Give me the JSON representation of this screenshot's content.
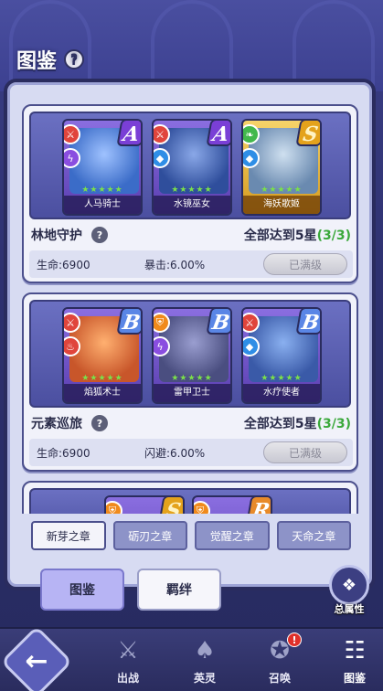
{
  "header": {
    "title": "图鉴",
    "help_icon": "?"
  },
  "sets": [
    {
      "name": "林地守护",
      "requirement": "全部达到5星",
      "progress": "(3/3)",
      "stat1": "生命:6900",
      "stat2": "暴击:6.00%",
      "button": "已满级",
      "heroes": [
        {
          "name": "人马骑士",
          "grade": "A",
          "frame": "purple",
          "stars": "★★★★★",
          "badges": [
            "red",
            "purple"
          ],
          "portrait": "#3b6cc8"
        },
        {
          "name": "水镜巫女",
          "grade": "A",
          "frame": "purple",
          "stars": "★★★★★",
          "badges": [
            "red",
            "blue"
          ],
          "portrait": "#2f4e9c"
        },
        {
          "name": "海妖歌姬",
          "grade": "S",
          "frame": "gold",
          "stars": "★★★★★",
          "badges": [
            "green",
            "blue"
          ],
          "portrait": "#6a8ab0"
        }
      ]
    },
    {
      "name": "元素巡旅",
      "requirement": "全部达到5星",
      "progress": "(3/3)",
      "stat1": "生命:6900",
      "stat2": "闪避:6.00%",
      "button": "已满级",
      "heroes": [
        {
          "name": "焰狐术士",
          "grade": "B",
          "frame": "purple",
          "stars": "★★★★★",
          "badges": [
            "red",
            "red"
          ],
          "portrait": "#c8562a"
        },
        {
          "name": "雷甲卫士",
          "grade": "B",
          "frame": "purple",
          "stars": "★★★★★",
          "badges": [
            "orange",
            "purple"
          ],
          "portrait": "#4a4e80"
        },
        {
          "name": "水疗使者",
          "grade": "B",
          "frame": "purple",
          "stars": "★★★★★",
          "badges": [
            "red",
            "blue"
          ],
          "portrait": "#3a5aa8"
        }
      ]
    },
    {
      "heroes": [
        {
          "grade": "S",
          "badge": "orange"
        },
        {
          "grade": "R",
          "badge": "orange"
        }
      ]
    }
  ],
  "chapters": [
    "新芽之章",
    "砺刃之章",
    "觉醒之章",
    "天命之章"
  ],
  "tabs": {
    "catalog": "图鉴",
    "bond": "羁绊"
  },
  "total_attr": "总属性",
  "nav": {
    "battle": "出战",
    "heroes": "英灵",
    "summon": "召唤",
    "catalog": "图鉴",
    "summon_badge": "!"
  },
  "colors": {
    "accent": "#b7b4f4",
    "progress_green": "#3aa83a",
    "notif_red": "#e0302a"
  }
}
